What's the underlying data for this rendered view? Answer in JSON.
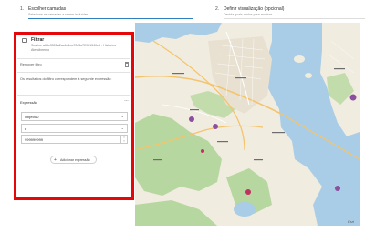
{
  "steps": [
    {
      "num": "1.",
      "title": "Escolher camadas",
      "subtitle": "Selecione as camadas a serem incluídas."
    },
    {
      "num": "2.",
      "title": "Definir visualização (opcional)",
      "subtitle": "Decida quais dados para mostrar."
    }
  ],
  "filter": {
    "title": "Filtrar",
    "subtitle": "Service a65c3301a2ac4e1ca70c3a729b1340c4 - Historico Atendimento",
    "remove_label": "Remover filtro",
    "result_text": "Os resultados do filtro correspondem à seguinte expressão:",
    "expression_label": "Expressão",
    "field_value": "ObjectID",
    "operator_value": "é",
    "input_value": "999999999",
    "add_expression_label": "Adicionar expressão"
  },
  "colors": {
    "highlight_border": "#e5080a",
    "active_step": "#2f7fc1",
    "water": "#a9cde6",
    "land": "#f1ece0"
  },
  "map": {
    "attribution": "Esri"
  }
}
